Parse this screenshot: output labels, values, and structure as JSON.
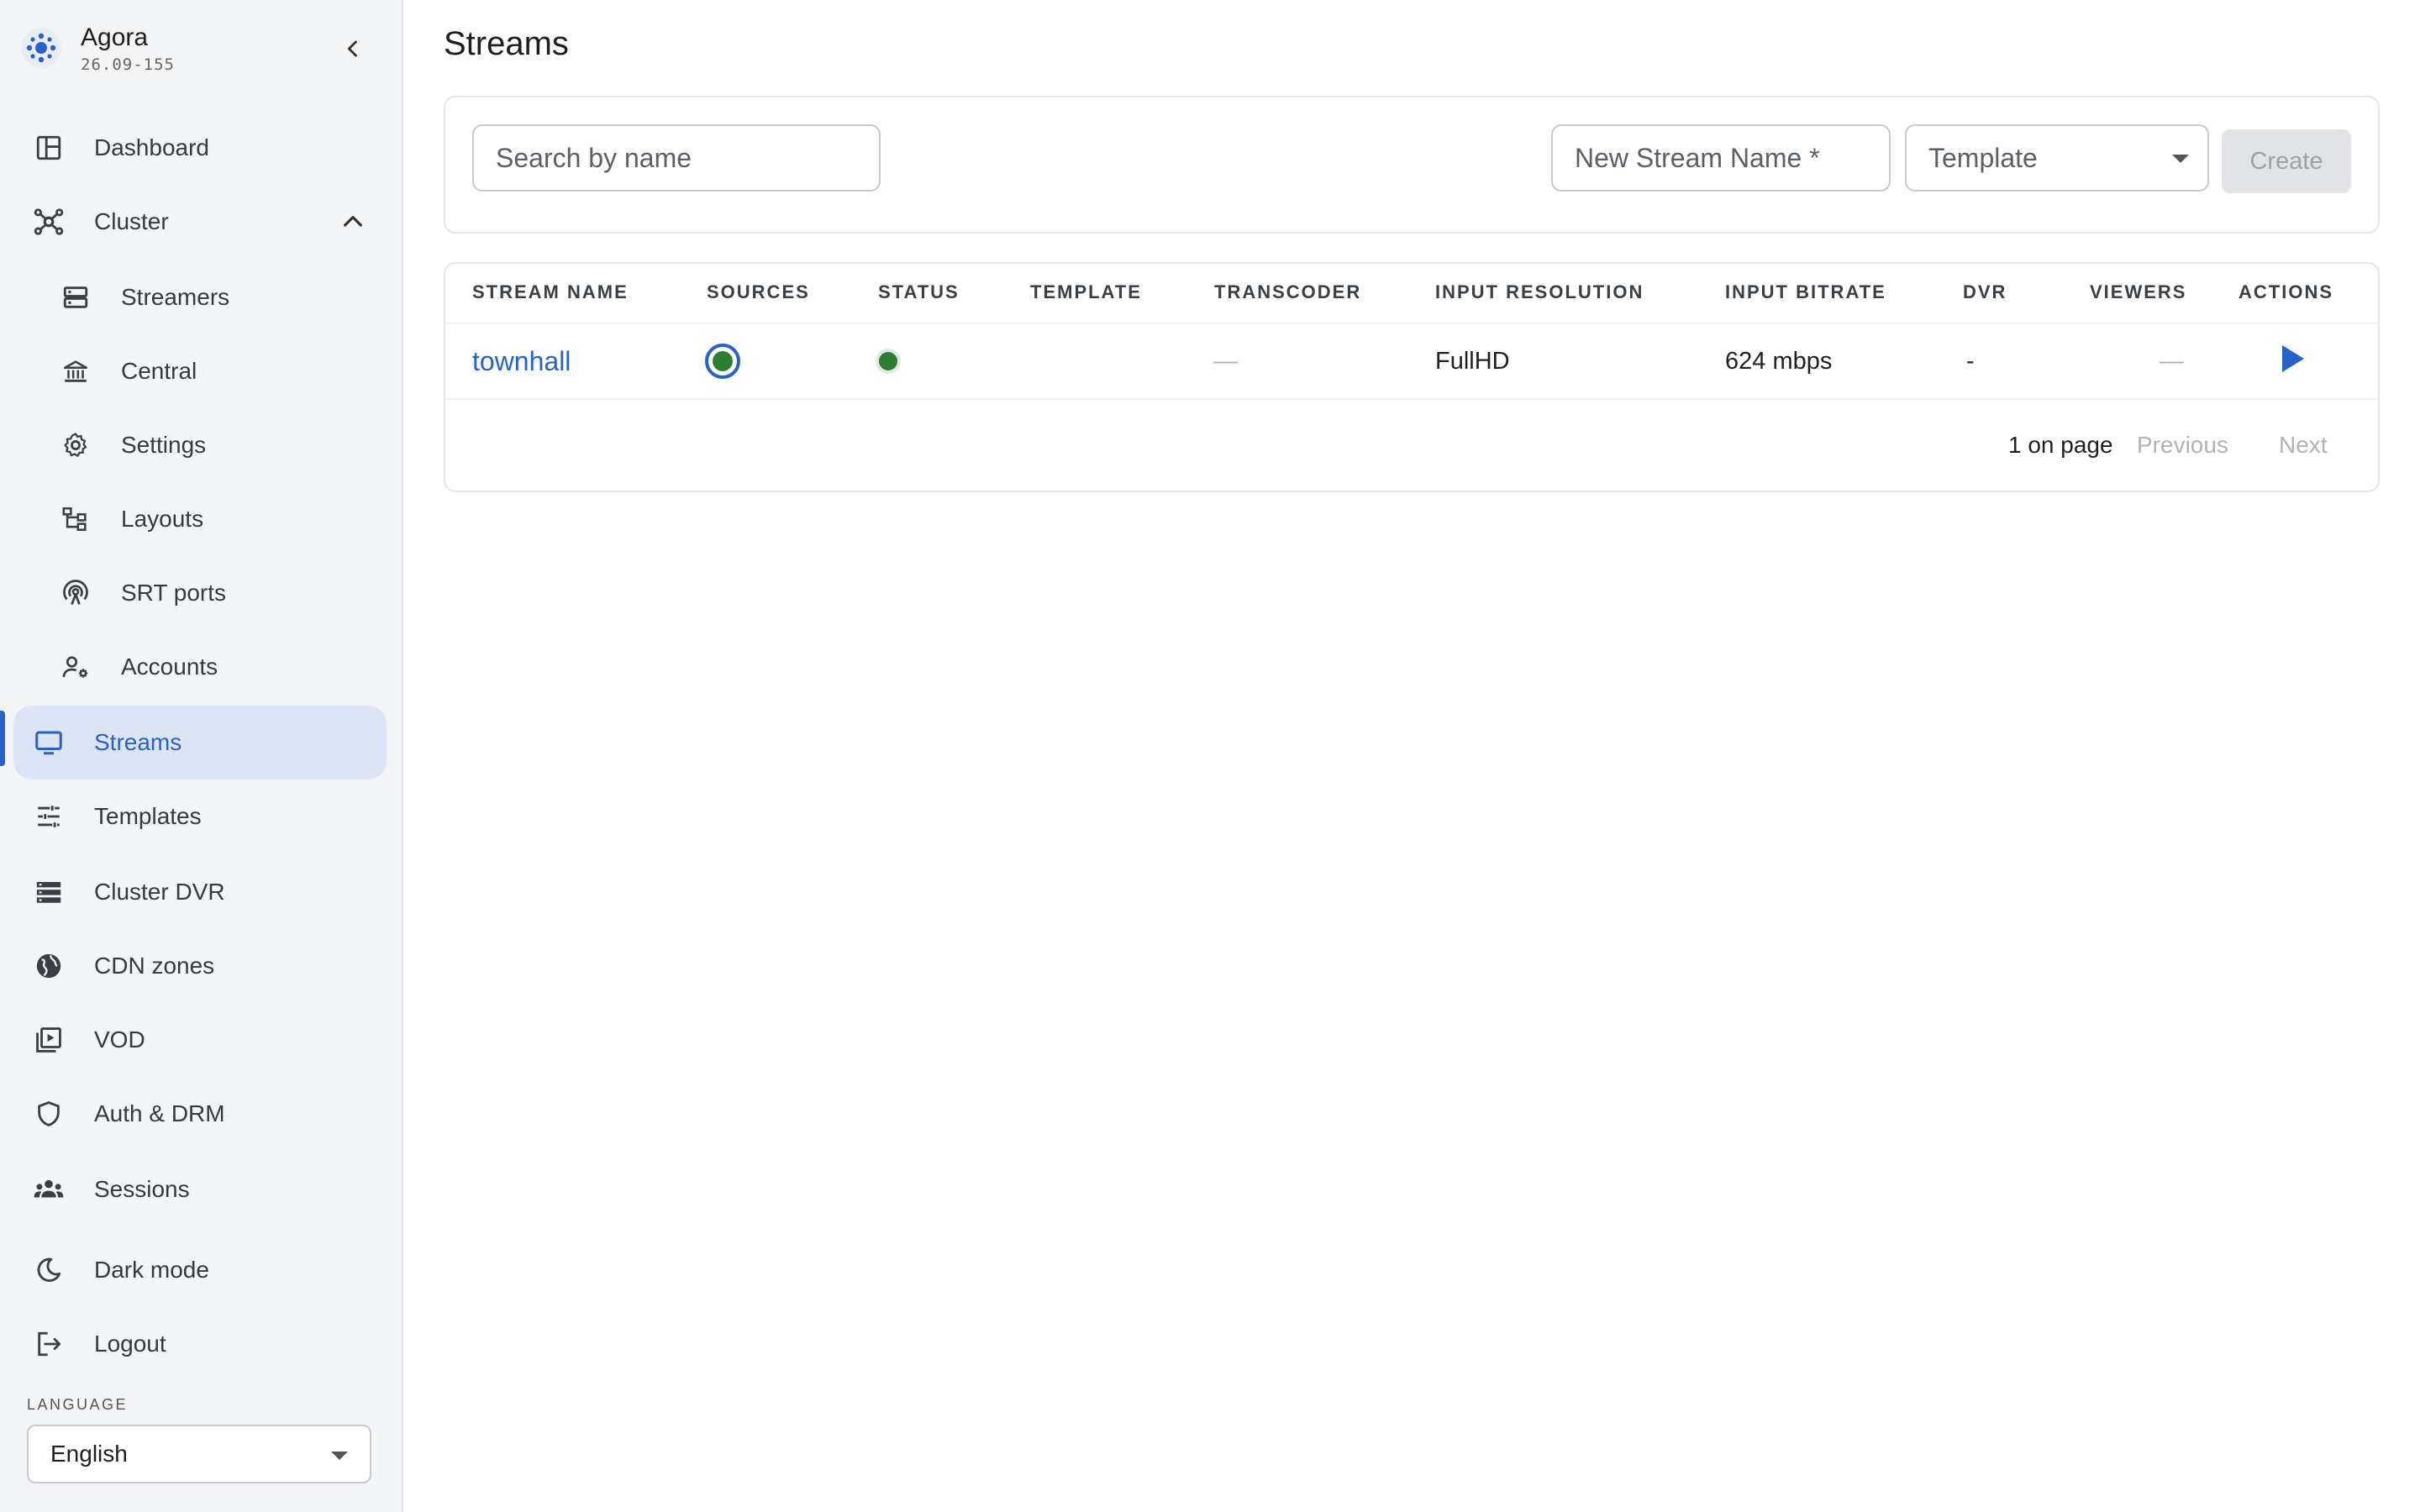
{
  "app": {
    "name": "Agora",
    "version": "26.09-155"
  },
  "sidebar": {
    "items": [
      {
        "label": "Dashboard",
        "icon": "dashboard-icon"
      },
      {
        "label": "Cluster",
        "icon": "cluster-icon",
        "expanded": true
      },
      {
        "label": "Streamers",
        "icon": "server-icon"
      },
      {
        "label": "Central",
        "icon": "bank-icon"
      },
      {
        "label": "Settings",
        "icon": "gear-icon"
      },
      {
        "label": "Layouts",
        "icon": "layout-tree-icon"
      },
      {
        "label": "SRT ports",
        "icon": "antenna-icon"
      },
      {
        "label": "Accounts",
        "icon": "user-gear-icon"
      },
      {
        "label": "Streams",
        "icon": "monitor-icon",
        "active": true
      },
      {
        "label": "Templates",
        "icon": "sliders-icon"
      },
      {
        "label": "Cluster DVR",
        "icon": "storage-icon"
      },
      {
        "label": "CDN zones",
        "icon": "globe-icon"
      },
      {
        "label": "VOD",
        "icon": "video-library-icon"
      },
      {
        "label": "Auth & DRM",
        "icon": "shield-icon"
      },
      {
        "label": "Sessions",
        "icon": "group-icon"
      },
      {
        "label": "Dark mode",
        "icon": "moon-icon"
      },
      {
        "label": "Logout",
        "icon": "logout-icon"
      }
    ],
    "language": {
      "caption": "LANGUAGE",
      "value": "English"
    }
  },
  "main": {
    "title": "Streams",
    "search_placeholder": "Search by name",
    "new_stream_placeholder": "New Stream Name *",
    "template_placeholder": "Template",
    "create_label": "Create",
    "table": {
      "columns": [
        "STREAM NAME",
        "SOURCES",
        "STATUS",
        "TEMPLATE",
        "TRANSCODER",
        "INPUT RESOLUTION",
        "INPUT BITRATE",
        "DVR",
        "VIEWERS",
        "ACTIONS"
      ],
      "rows": [
        {
          "name": "townhall",
          "template": "",
          "transcoder": "—",
          "input_resolution": "FullHD",
          "input_bitrate": "624 mbps",
          "dvr": "-",
          "viewers": "—"
        }
      ]
    },
    "pagination": {
      "count": "1 on page",
      "previous": "Previous",
      "next": "Next"
    }
  },
  "colors": {
    "accent": "#2861c8",
    "status_ok": "#2e7d32",
    "active_bg": "#dde5f5"
  }
}
